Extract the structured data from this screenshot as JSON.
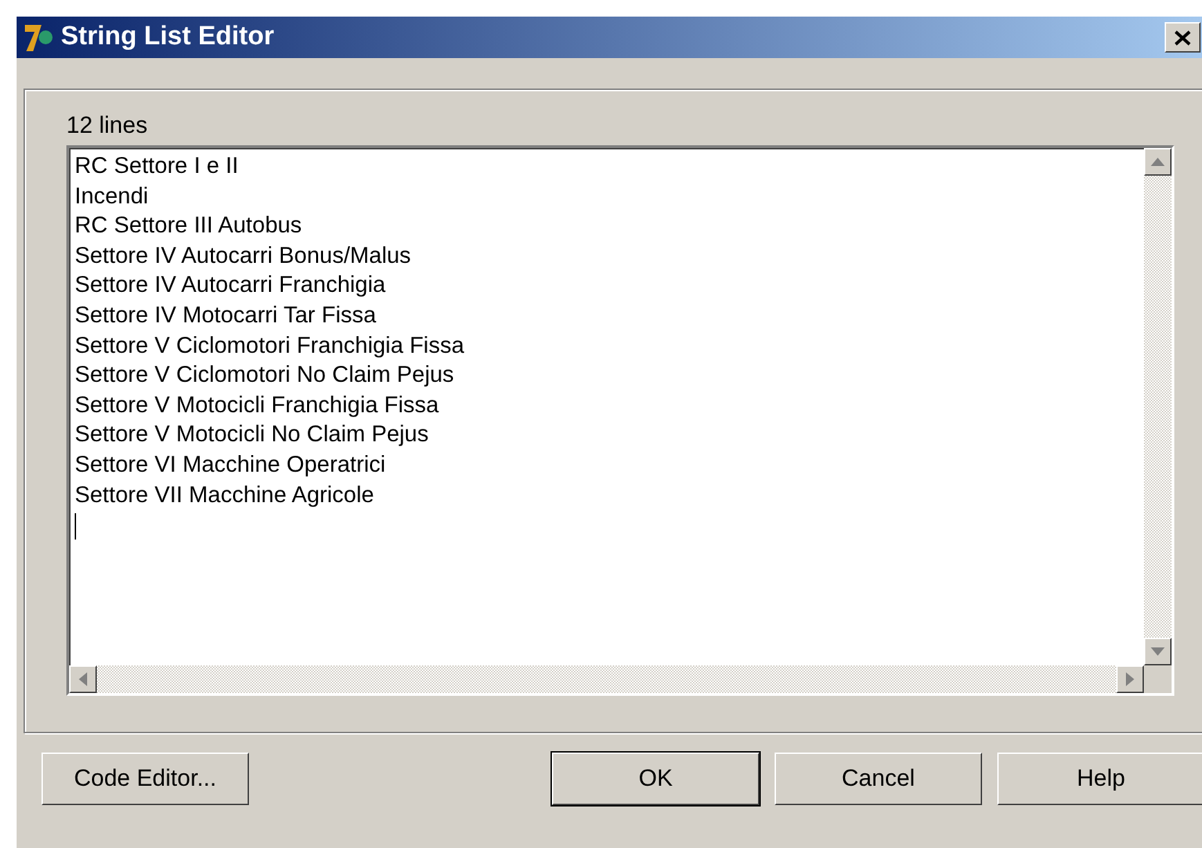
{
  "window": {
    "title": "String List Editor"
  },
  "line_count": "12 lines",
  "lines": [
    "RC Settore I e II",
    "Incendi",
    "RC Settore III Autobus",
    "Settore IV Autocarri Bonus/Malus",
    "Settore IV Autocarri Franchigia",
    "Settore IV Motocarri Tar Fissa",
    "Settore V Ciclomotori Franchigia Fissa",
    "Settore V Ciclomotori No Claim Pejus",
    "Settore V Motocicli Franchigia Fissa",
    "Settore V Motocicli No Claim Pejus",
    "Settore VI Macchine Operatrici",
    "Settore VII Macchine Agricole"
  ],
  "buttons": [
    {
      "label": "Code Editor...",
      "kind": "left",
      "default": false
    },
    {
      "label": "OK",
      "kind": "right",
      "default": true
    },
    {
      "label": "Cancel",
      "kind": "right",
      "default": false
    },
    {
      "label": "Help",
      "kind": "right",
      "default": false
    }
  ]
}
